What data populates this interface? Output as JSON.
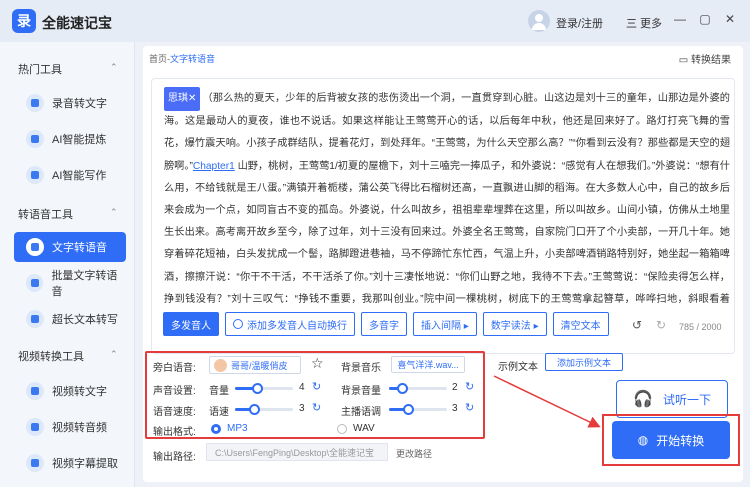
{
  "app": {
    "logo": "录",
    "title": "全能速记宝",
    "login": "登录/注册",
    "more": "三 更多"
  },
  "window": {
    "minimize": "—",
    "maximize": "▢",
    "close": "✕"
  },
  "sidebar": {
    "groups": [
      {
        "title": "热门工具",
        "chevron": "⌃"
      },
      {
        "title": "转语音工具",
        "chevron": "⌃"
      },
      {
        "title": "视频转换工具",
        "chevron": "⌃"
      }
    ],
    "items": [
      {
        "label": "录音转文字"
      },
      {
        "label": "AI智能提炼"
      },
      {
        "label": "AI智能写作"
      },
      {
        "label": "文字转语音"
      },
      {
        "label": "批量文字转语音"
      },
      {
        "label": "超长文本转写"
      },
      {
        "label": "视频转文字"
      },
      {
        "label": "视频转音频"
      },
      {
        "label": "视频字幕提取"
      }
    ]
  },
  "breadcrumb": {
    "home": "首页-",
    "current": "文字转语音"
  },
  "convert_result": "转换结果",
  "editor": {
    "speaker_tag": "思琪✕",
    "text_1": "（那么热的夏天，少年的后背被女孩的悲伤烫出一个洞，一直贯穿到心脏。山这边是刘十三的童年，山那边是外婆的海。这是最动人的夏夜，谁也不说话。如果这样能让王莺莺开心的话，以后每年中秋，他还是回来好了。路灯打亮飞舞的雪花，爆竹震天响。小孩子成群结队，提着花灯，到处拜年。“王莺莺，为什么天空那么高？”“你看到云没有？那些都是天空的翅膀啊。”",
    "chapter": "Chapter1",
    "text_2": " 山野，桃树，王莺莺1/初夏的屋檐下，刘十三嗑完一捧瓜子，和外婆说：“感觉有人在想我们。”外婆说：“想有什么用，不给钱就是王八蛋。”满镇开着栀楼，蒲公英飞得比石榴树还高，一直飘进山脚的稻海。在大多数人心中，自己的故乡后来会成为一个点，如同盲古不变的孤岛。外婆说，什么叫故乡，祖祖辈辈埋葬在这里，所以叫故乡。山间小镇，仿佛从土地里生长出来。高考离开故乡至今，除了过年，刘十三没有回来过。外婆全名王莺莺，自家院门口开了个小卖部，一开几十年。她穿着碎花短袖，白头发扰成一个髻，路脚蹬进巷袖，马不停蹄忙东忙西，气温上升，小卖部啤酒销路特别好，她坐起一箱箱啤酒，擦擦汗说：“你干不干活，不干活杀了你。”刘十三凄怅地说：“你们山野之地，我待不下去。”王莺莺说：“保险卖得怎么样，挣到钱没有？”刘十三叹气：“挣钱不重要，我那叫创业。”院中间一棵桃树，树底下的王莺莺拿起簪草，哗哗扫地，斜眼看着他：“要不这样，我把房子卖了，支持你创业。”刘十三惊住地：“外婆，我爱你。”外婆一脚踢开他：“去去去。”刘十三问：“中午吃"
  },
  "toolbar": {
    "multi_speaker": "多发音人",
    "add_auto_switch": "添加多发音人自动换行",
    "polyphonic": "多音字",
    "insert_pause": "插入间隔 ▸",
    "digit_read": "数字读法 ▸",
    "clear_text": "清空文本",
    "undo": "↺",
    "redo": "↻",
    "counter": "785 / 2000"
  },
  "settings": {
    "voice_label": "旁白语音:",
    "voice_name": "哥哥/温暖俏皮",
    "favorite": "☆",
    "music_label": "背景音乐",
    "music_name": "喜气洋洋.wav...",
    "sound_setting_label": "声音设置:",
    "volume_label": "音量",
    "volume_value": "4",
    "bg_volume_label": "背景音量",
    "bg_volume_value": "2",
    "speed_setting_label": "语音速度:",
    "speed_label": "语速",
    "speed_value": "3",
    "pitch_label": "主播语调",
    "pitch_value": "3",
    "reset": "↻",
    "format_label": "输出格式:",
    "format_mp3": "MP3",
    "format_wav": "WAV",
    "levels": {
      "volume": 0.38,
      "bg_volume": 0.22,
      "speed": 0.32,
      "pitch": 0.32
    }
  },
  "example": {
    "label": "示例文本",
    "add": "添加示例文本"
  },
  "listen": "试听一下",
  "start": "开始转换",
  "output": {
    "label": "输出路径:",
    "path": "C:\\Users\\FengPing\\Desktop\\全能速记宝",
    "change": "更改路径"
  },
  "colors": {
    "accent": "#2f6df6",
    "highlight": "#e43b3b"
  }
}
